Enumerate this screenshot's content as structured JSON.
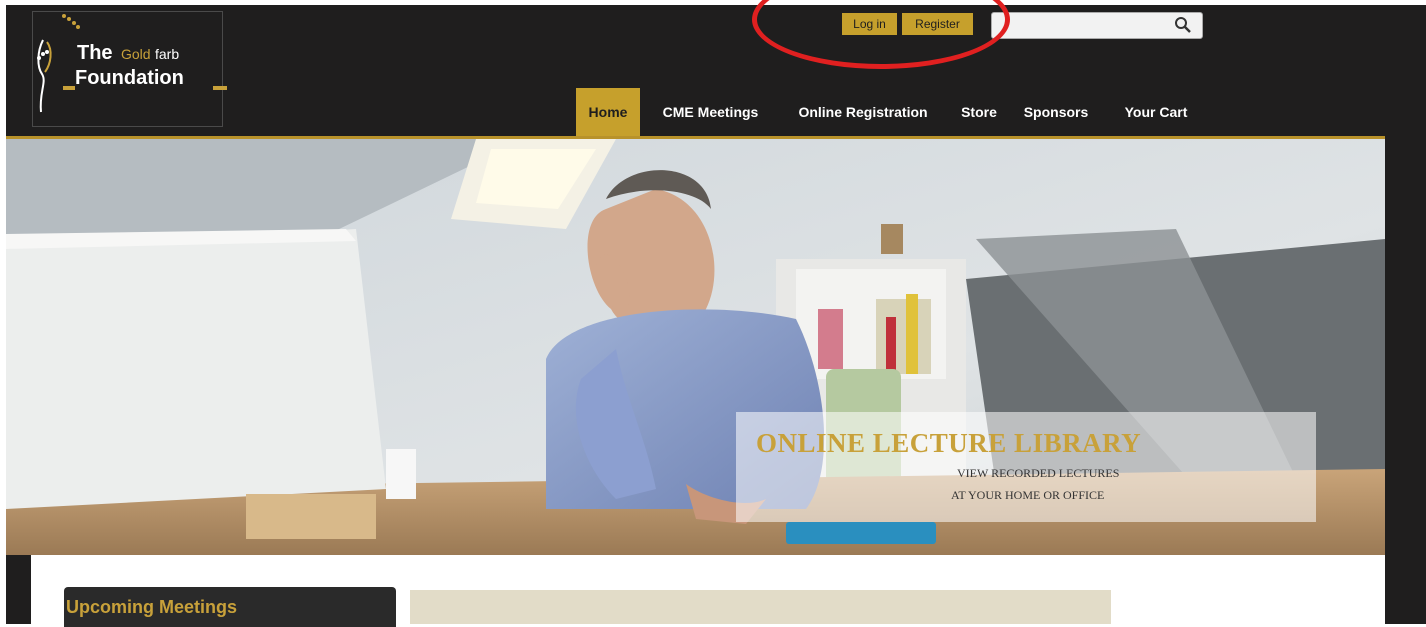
{
  "logo": {
    "the": "The",
    "gold": "Gold",
    "farb": "farb",
    "foundation": "Foundation"
  },
  "auth": {
    "login_label": "Log in",
    "register_label": "Register"
  },
  "search": {
    "value": "",
    "placeholder": ""
  },
  "nav": {
    "items": [
      "Home",
      "CME Meetings",
      "Online Registration",
      "Store",
      "Sponsors",
      "Your Cart"
    ],
    "active": "Home"
  },
  "hero": {
    "title": "ONLINE LECTURE LIBRARY",
    "sub1": "VIEW RECORDED LECTURES",
    "sub2": "AT YOUR HOME OR OFFICE"
  },
  "sidebar": {
    "title": "Upcoming Meetings"
  },
  "colors": {
    "header_bg": "#1f1e1e",
    "accent_gold": "#c6a02c",
    "annotation_red": "#e02020"
  }
}
